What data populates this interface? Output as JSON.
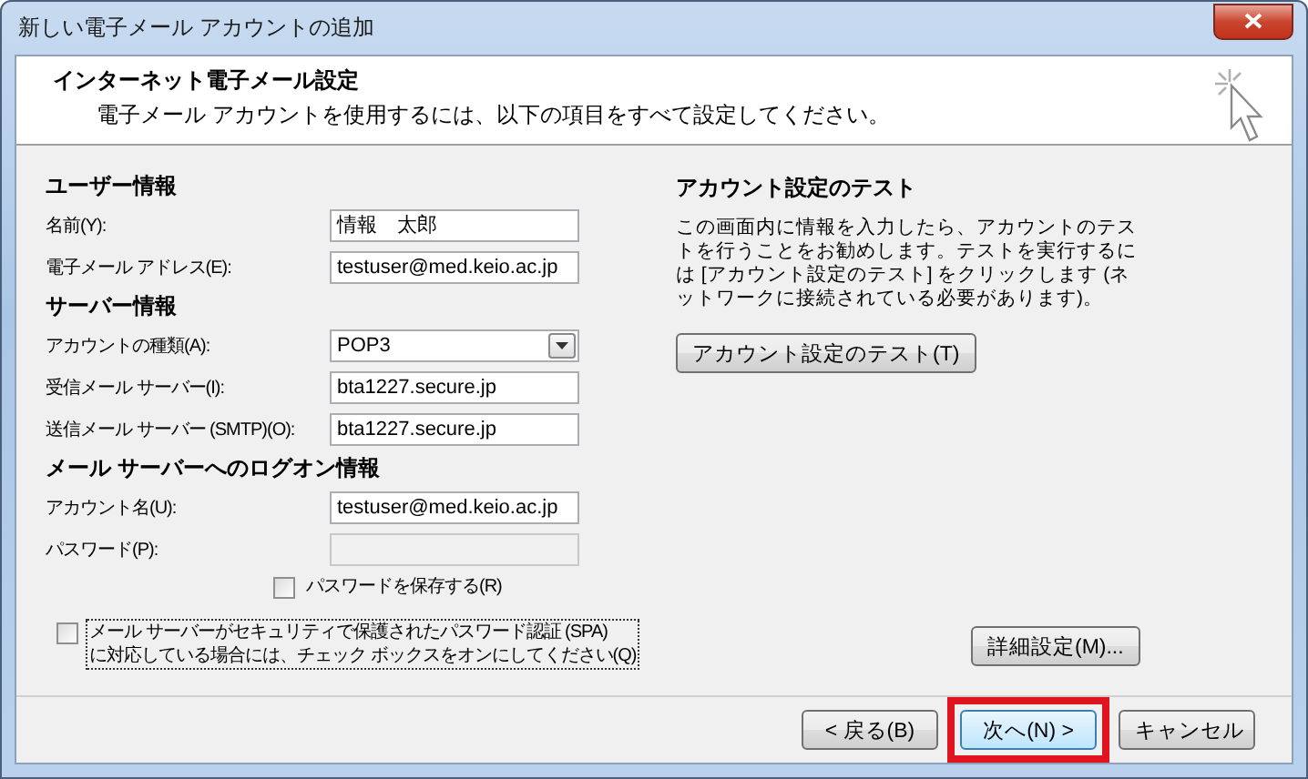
{
  "window": {
    "title": "新しい電子メール アカウントの追加"
  },
  "header": {
    "title": "インターネット電子メール設定",
    "subtitle": "電子メール アカウントを使用するには、以下の項目をすべて設定してください。"
  },
  "sections": [
    {
      "heading": "ユーザー情報",
      "fields": [
        {
          "kind": "text",
          "label": "名前(Y):",
          "value": "情報　太郎",
          "disabled": false
        },
        {
          "kind": "text",
          "label": "電子メール アドレス(E):",
          "value": "testuser@med.keio.ac.jp",
          "disabled": false
        }
      ]
    },
    {
      "heading": "サーバー情報",
      "fields": [
        {
          "kind": "select",
          "label": "アカウントの種類(A):",
          "value": "POP3",
          "disabled": false
        },
        {
          "kind": "text",
          "label": "受信メール サーバー(I):",
          "value": "bta1227.secure.jp",
          "disabled": false
        },
        {
          "kind": "text",
          "label": "送信メール サーバー (SMTP)(O):",
          "value": "bta1227.secure.jp",
          "disabled": false
        }
      ]
    },
    {
      "heading": "メール サーバーへのログオン情報",
      "fields": [
        {
          "kind": "text",
          "label": "アカウント名(U):",
          "value": "testuser@med.keio.ac.jp",
          "disabled": false
        },
        {
          "kind": "text",
          "label": "パスワード(P):",
          "disabled": true
        }
      ]
    }
  ],
  "save_password": {
    "label": "パスワードを保存する(R)",
    "checked": false
  },
  "spa": {
    "label_lines": [
      "メール サーバーがセキュリティで保護されたパスワード認証 (SPA)",
      "に対応している場合には、チェック ボックスをオンにしてください(Q)"
    ],
    "checked": false,
    "focused": true
  },
  "test_panel": {
    "heading": "アカウント設定のテスト",
    "text": "この画面内に情報を入力したら、アカウントのテストを行うことをお勧めします。テストを実行するには [アカウント設定のテスト] をクリックします (ネットワークに接続されている必要があります)。",
    "button": "アカウント設定のテスト(T)"
  },
  "advanced_button": "詳細設定(M)...",
  "buttons": [
    {
      "label": "< 戻る(B)",
      "default": false,
      "highlighted": false
    },
    {
      "label": "次へ(N) >",
      "default": true,
      "highlighted": true
    },
    {
      "label": "キャンセル",
      "default": false,
      "highlighted": false
    }
  ]
}
